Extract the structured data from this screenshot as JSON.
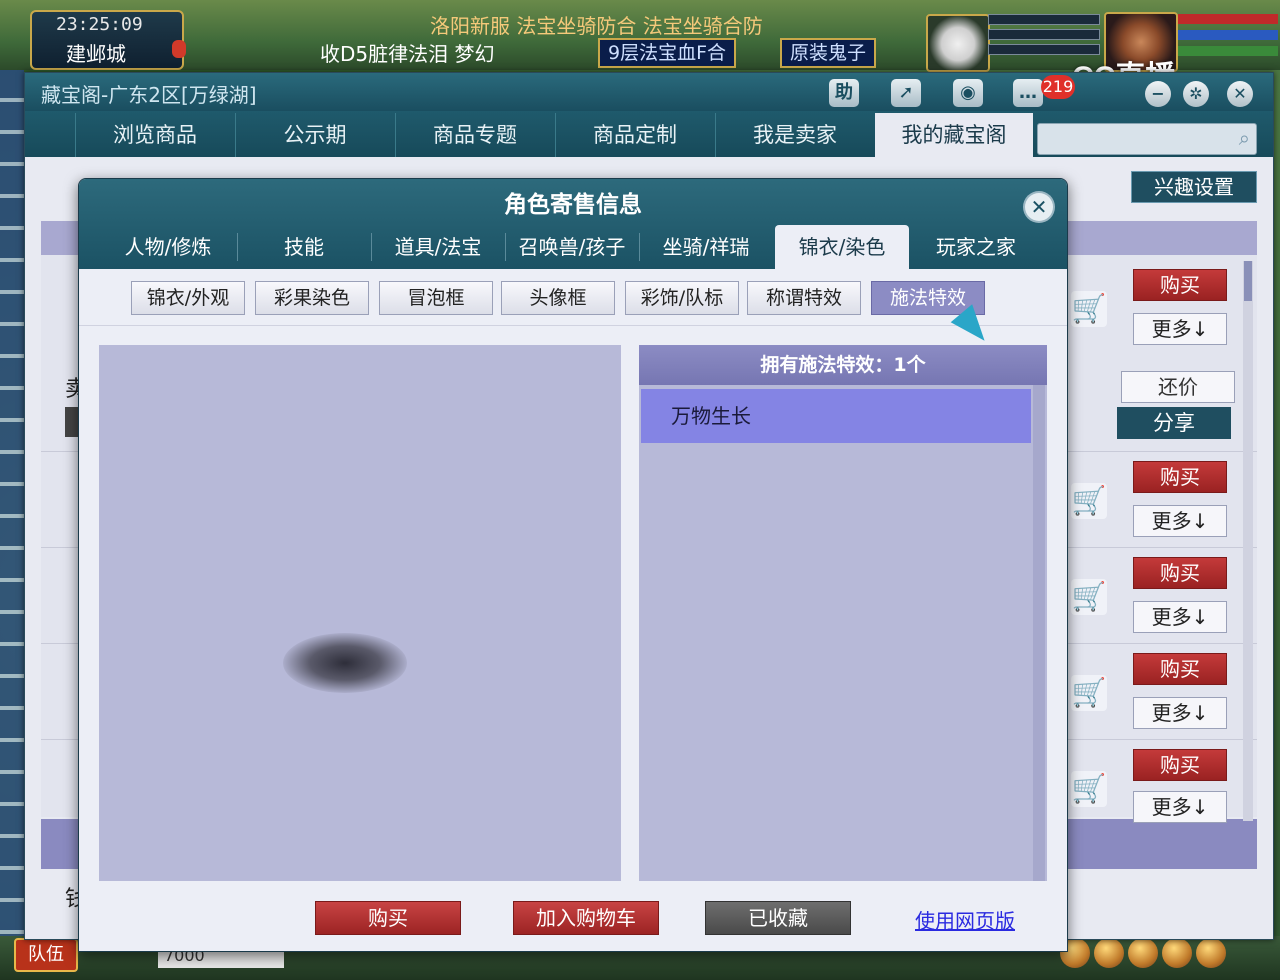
{
  "game": {
    "time": "23:25:09",
    "city": "建邺城",
    "ticker_top": "洛阳新服 法宝坐骑防合 法宝坐骑合防",
    "ticker_bottom": "收D5脏律法泪 梦幻",
    "chips": [
      "9层法宝血F合",
      "原装鬼子"
    ],
    "stream_logo": "CC直播",
    "team_label": "队伍",
    "money": "7000"
  },
  "window": {
    "title": "藏宝阁-广东2区[万绿湖]",
    "toolbar": {
      "help": "助",
      "badge_count": "219"
    },
    "nav_tabs": [
      {
        "label": "浏览商品"
      },
      {
        "label": "公示期"
      },
      {
        "label": "商品专题"
      },
      {
        "label": "商品定制"
      },
      {
        "label": "我是卖家"
      },
      {
        "label": "我的藏宝阁"
      }
    ],
    "search_placeholder": "",
    "interest_settings": "兴趣设置",
    "row_actions": {
      "buy": "购买",
      "more": "更多↓",
      "counter_offer": "还价",
      "share": "分享"
    },
    "side_char_top": "卖",
    "side_char_bottom": "钱"
  },
  "modal": {
    "title": "角色寄售信息",
    "tabs": [
      {
        "label": "人物/修炼"
      },
      {
        "label": "技能"
      },
      {
        "label": "道具/法宝"
      },
      {
        "label": "召唤兽/孩子"
      },
      {
        "label": "坐骑/祥瑞"
      },
      {
        "label": "锦衣/染色"
      },
      {
        "label": "玩家之家"
      }
    ],
    "active_tab": "锦衣/染色",
    "subtabs": [
      {
        "label": "锦衣/外观"
      },
      {
        "label": "彩果染色"
      },
      {
        "label": "冒泡框"
      },
      {
        "label": "头像框"
      },
      {
        "label": "彩饰/队标"
      },
      {
        "label": "称谓特效"
      },
      {
        "label": "施法特效"
      }
    ],
    "active_subtab": "施法特效",
    "effects_header": "拥有施法特效：1个",
    "effects": [
      "万物生长"
    ],
    "buttons": {
      "buy": "购买",
      "add_to_cart": "加入购物车",
      "favorited": "已收藏",
      "web_version": "使用网页版"
    }
  },
  "colors": {
    "titlebar": "#1b5264",
    "accent_purple": "#8c8cc4",
    "buy_red": "#b02e2e",
    "selected_item": "#8484e4"
  }
}
